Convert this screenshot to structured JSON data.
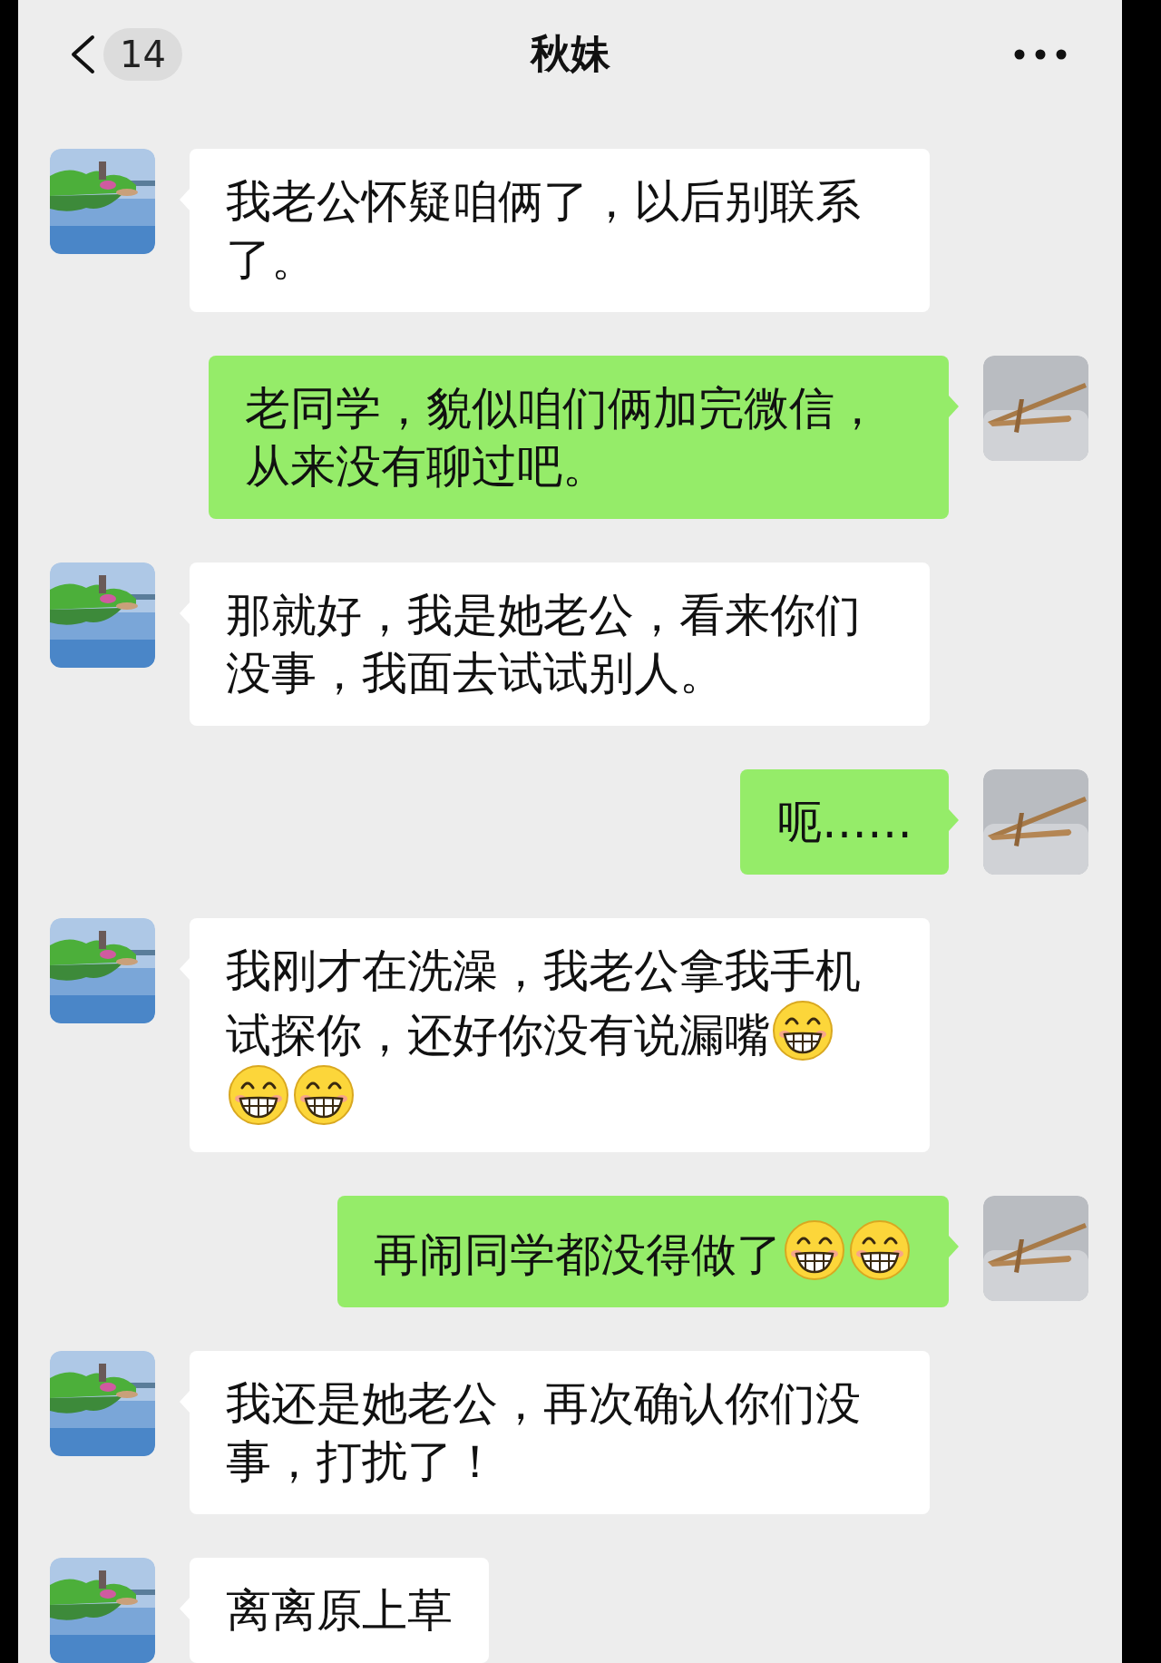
{
  "header": {
    "unread_count": "14",
    "title": "秋妹"
  },
  "messages": [
    {
      "kind": "received",
      "segments": [
        {
          "kind": "text",
          "text": "我老公怀疑咱俩了，以后别联系了。"
        }
      ]
    },
    {
      "kind": "sent",
      "segments": [
        {
          "kind": "text",
          "text": "老同学，貌似咱们俩加完微信，从来没有聊过吧。"
        }
      ]
    },
    {
      "kind": "received",
      "segments": [
        {
          "kind": "text",
          "text": "那就好，我是她老公，看来你们没事，我面去试试别人。"
        }
      ]
    },
    {
      "kind": "sent",
      "segments": [
        {
          "kind": "text",
          "text": "呃……"
        }
      ]
    },
    {
      "kind": "received",
      "segments": [
        {
          "kind": "text",
          "text": "我刚才在洗澡，我老公拿我手机"
        },
        {
          "kind": "text",
          "text": "试探你，还好你没有说漏嘴"
        },
        {
          "kind": "emoji"
        },
        {
          "kind": "emoji"
        },
        {
          "kind": "emoji"
        }
      ]
    },
    {
      "kind": "sent",
      "segments": [
        {
          "kind": "text",
          "text": "再闹同学都没得做了"
        },
        {
          "kind": "emoji"
        },
        {
          "kind": "emoji"
        }
      ]
    },
    {
      "kind": "received",
      "segments": [
        {
          "kind": "text",
          "text": "我还是她老公，再次确认你们没事，打扰了！"
        }
      ]
    },
    {
      "kind": "received",
      "segments": [
        {
          "kind": "text",
          "text": "离离原上草"
        }
      ]
    }
  ]
}
